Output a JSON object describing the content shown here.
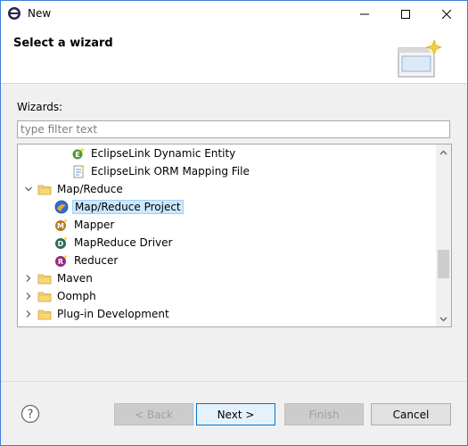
{
  "window": {
    "title": "New"
  },
  "header": {
    "title": "Select a wizard"
  },
  "wizards": {
    "label": "Wizards:",
    "filter_placeholder": "type filter text"
  },
  "tree": {
    "rows": [
      {
        "label": "EclipseLink Dynamic Entity",
        "icon": "eclipselink-entity-icon",
        "twisty": "none",
        "indent": 2,
        "selected": false
      },
      {
        "label": "EclipseLink ORM Mapping File",
        "icon": "eclipselink-orm-file-icon",
        "twisty": "none",
        "indent": 2,
        "selected": false
      },
      {
        "label": "Map/Reduce",
        "icon": "folder-icon",
        "twisty": "expanded",
        "indent": 0,
        "selected": false
      },
      {
        "label": "Map/Reduce Project",
        "icon": "mapreduce-project-icon",
        "twisty": "none",
        "indent": 1,
        "selected": true
      },
      {
        "label": "Mapper",
        "icon": "mapper-icon",
        "twisty": "none",
        "indent": 1,
        "selected": false
      },
      {
        "label": "MapReduce Driver",
        "icon": "mapreduce-driver-icon",
        "twisty": "none",
        "indent": 1,
        "selected": false
      },
      {
        "label": "Reducer",
        "icon": "reducer-icon",
        "twisty": "none",
        "indent": 1,
        "selected": false
      },
      {
        "label": "Maven",
        "icon": "folder-icon",
        "twisty": "collapsed",
        "indent": 0,
        "selected": false
      },
      {
        "label": "Oomph",
        "icon": "folder-icon",
        "twisty": "collapsed",
        "indent": 0,
        "selected": false
      },
      {
        "label": "Plug-in Development",
        "icon": "folder-icon",
        "twisty": "collapsed",
        "indent": 0,
        "selected": false
      }
    ]
  },
  "buttons": {
    "back": "< Back",
    "next": "Next >",
    "finish": "Finish",
    "cancel": "Cancel"
  },
  "colors": {
    "selection_bg": "#cce8ff",
    "selection_border": "#99d1ff",
    "window_border": "#3c7fd6",
    "default_button": "#0078d7"
  }
}
